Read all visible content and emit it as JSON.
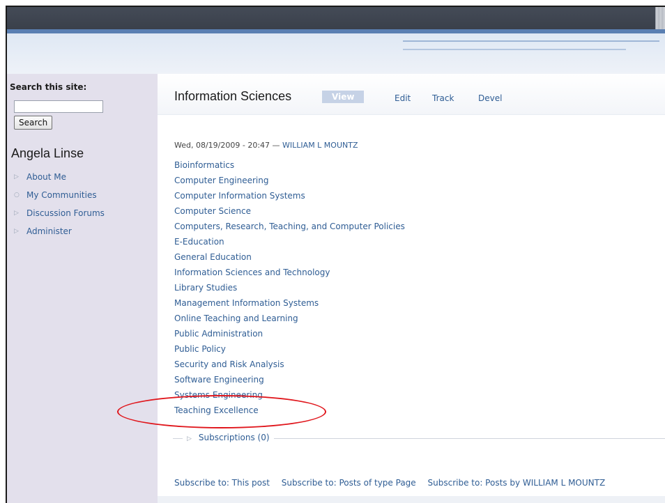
{
  "sidebar": {
    "search_label": "Search this site:",
    "search_value": "",
    "search_button": "Search",
    "user_name": "Angela Linse",
    "items": [
      {
        "label": "About Me",
        "bullet": "▷"
      },
      {
        "label": "My Communities",
        "bullet": "○"
      },
      {
        "label": "Discussion Forums",
        "bullet": "▷"
      },
      {
        "label": "Administer",
        "bullet": "▷"
      }
    ]
  },
  "main": {
    "title": "Information Sciences",
    "tabs": [
      {
        "label": "View",
        "active": true
      },
      {
        "label": "Edit"
      },
      {
        "label": "Track"
      },
      {
        "label": "Devel"
      }
    ],
    "meta": {
      "date": "Wed, 08/19/2009 - 20:47",
      "separator": " — ",
      "author": "WILLIAM L MOUNTZ"
    },
    "terms": [
      "Bioinformatics",
      "Computer Engineering",
      "Computer Information Systems",
      "Computer Science",
      "Computers, Research, Teaching, and Computer Policies",
      "E-Education",
      "General Education",
      "Information Sciences and Technology",
      "Library Studies",
      "Management Information Systems",
      "Online Teaching and Learning",
      "Public Administration",
      "Public Policy",
      "Security and Risk Analysis",
      "Software Engineering",
      "Systems Engineering",
      "Teaching Excellence"
    ],
    "subscriptions_label": "Subscriptions (0)",
    "subscribe_links": [
      "Subscribe to: This post",
      "Subscribe to: Posts of type Page",
      "Subscribe to: Posts by WILLIAM L MOUNTZ"
    ]
  },
  "colors": {
    "link": "#2f5d94",
    "annotation": "#e0161c",
    "sidebar_bg": "#e3e0ec",
    "tab_active_bg": "#c6d2e6"
  }
}
